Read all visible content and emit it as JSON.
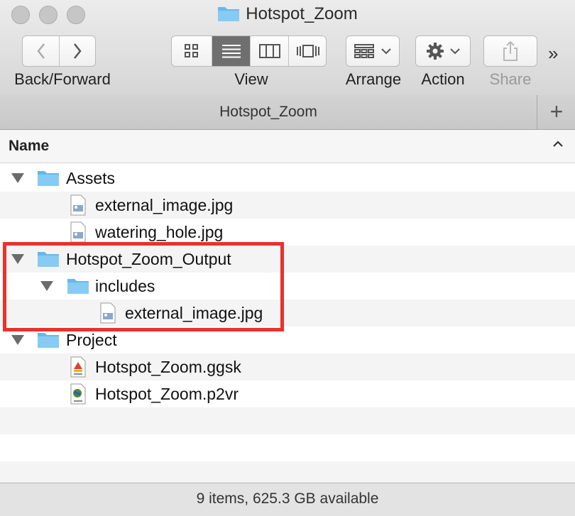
{
  "window": {
    "title": "Hotspot_Zoom",
    "folder_icon": "folder-icon"
  },
  "toolbar": {
    "back_forward_label": "Back/Forward",
    "view_label": "View",
    "arrange_label": "Arrange",
    "action_label": "Action",
    "share_label": "Share",
    "overflow": "»",
    "active_view": "list"
  },
  "tab": {
    "label": "Hotspot_Zoom",
    "add": "+"
  },
  "columns": {
    "name": "Name"
  },
  "files": [
    {
      "label": "Assets",
      "type": "folder",
      "expanded": true
    },
    {
      "label": "external_image.jpg",
      "type": "image"
    },
    {
      "label": "watering_hole.jpg",
      "type": "image"
    },
    {
      "label": "Hotspot_Zoom_Output",
      "type": "folder",
      "expanded": true
    },
    {
      "label": "includes",
      "type": "folder",
      "expanded": true
    },
    {
      "label": "external_image.jpg",
      "type": "image"
    },
    {
      "label": "Project",
      "type": "folder",
      "expanded": true
    },
    {
      "label": "Hotspot_Zoom.ggsk",
      "type": "ggsk"
    },
    {
      "label": "Hotspot_Zoom.p2vr",
      "type": "p2vr"
    }
  ],
  "status": {
    "text": "9 items, 625.3 GB available"
  },
  "colors": {
    "highlight": "#e8322a",
    "folder": "#67b7ec"
  }
}
